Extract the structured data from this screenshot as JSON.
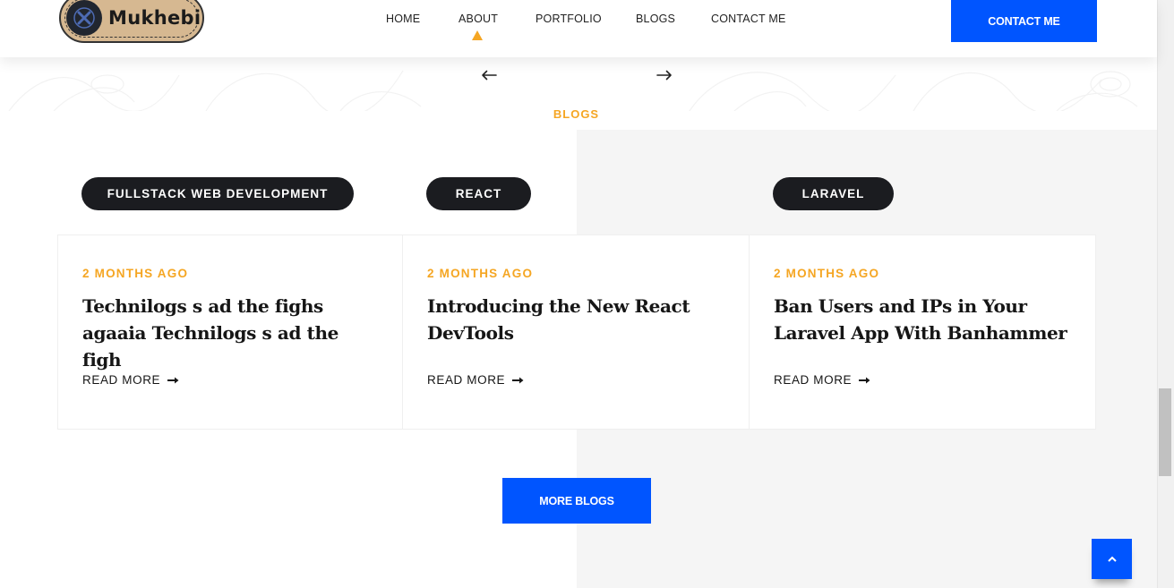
{
  "brand": {
    "name": "Mukhebi"
  },
  "nav": {
    "items": [
      {
        "label": "HOME"
      },
      {
        "label": "ABOUT"
      },
      {
        "label": "PORTFOLIO"
      },
      {
        "label": "BLOGS"
      },
      {
        "label": "CONTACT ME"
      }
    ],
    "active_item": "ABOUT",
    "cta_label": "CONTACT ME"
  },
  "section": {
    "label": "BLOGS"
  },
  "categories": [
    {
      "label": "FULLSTACK WEB DEVELOPMENT"
    },
    {
      "label": "REACT"
    },
    {
      "label": "LARAVEL"
    }
  ],
  "posts": [
    {
      "date": "2 MONTHS AGO",
      "title": "Technilogs s ad the fighs agaaia Technilogs s ad the figh",
      "link": "READ MORE"
    },
    {
      "date": "2 MONTHS AGO",
      "title": "Introducing the New React DevTools",
      "link": "READ MORE"
    },
    {
      "date": "2 MONTHS AGO",
      "title": "Ban Users and IPs in Your Laravel App With Banhammer",
      "link": "READ MORE"
    }
  ],
  "more_button": "MORE BLOGS",
  "icons": {
    "prev": "arrow-left-icon",
    "next": "arrow-right-icon",
    "read_more": "long-arrow-right-icon",
    "scroll_top": "chevron-up-icon",
    "logo": "tools-badge-icon"
  },
  "colors": {
    "accent": "#f5a623",
    "primary": "#0055ff",
    "pill": "#1b1c20",
    "muted_bg": "#f5f5f5"
  }
}
